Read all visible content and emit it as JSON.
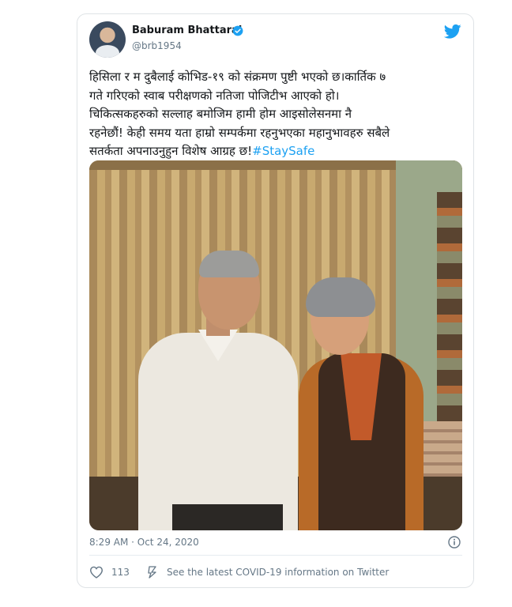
{
  "tweet": {
    "author_name": "Baburam Bhattarai",
    "handle": "@brb1954",
    "text": "हिसिला र म दुबैलाई कोभिड-१९ को संक्रमण पुष्टी भएको छ।कार्तिक ७\nगते गरिएको स्वाब परीक्षणको नतिजा पोजिटीभ आएको हो।\nचिकित्सकहरुको सल्लाह बमोजिम हामी होम आइसोलेसनमा नै\nरहनेछौं! केही समय यता हाम्रो सम्पर्कमा रहनुभएका महानुभावहरु सबैले\nसतर्कता अपनाउनुहुन विशेष आग्रह छ!",
    "hashtag": "#StaySafe",
    "timestamp": "8:29 AM · Oct 24, 2020",
    "like_count": "113",
    "covid_link": "See the latest COVID-19 information on Twitter"
  },
  "icons": {
    "verified": "verified-badge-icon",
    "brand": "twitter-bird-icon",
    "info": "info-icon",
    "like": "heart-icon",
    "covid": "covid-info-icon"
  },
  "colors": {
    "accent": "#1da1f2",
    "secondary_text": "#657786",
    "border": "#dfe3e6"
  }
}
